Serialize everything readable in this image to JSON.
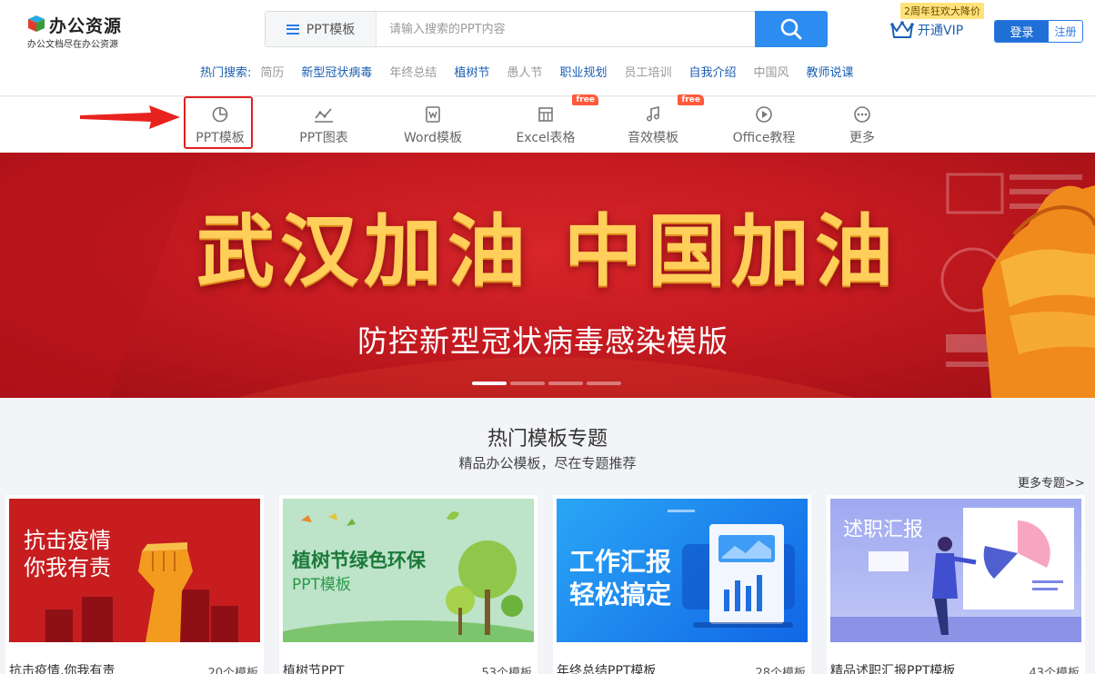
{
  "logo": {
    "title": "办公资源",
    "subtitle": "办公文档尽在办公资源"
  },
  "search": {
    "category": "PPT模板",
    "placeholder": "请输入搜索的PPT内容"
  },
  "promo": "2周年狂欢大降价",
  "vip": "开通VIP",
  "auth": {
    "login": "登录",
    "register": "注册"
  },
  "hot": {
    "label": "热门搜索:",
    "items": [
      {
        "text": "简历",
        "color": "#999999"
      },
      {
        "text": "新型冠状病毒",
        "color": "#1a5fb4"
      },
      {
        "text": "年终总结",
        "color": "#999999"
      },
      {
        "text": "植树节",
        "color": "#1a5fb4"
      },
      {
        "text": "愚人节",
        "color": "#999999"
      },
      {
        "text": "职业规划",
        "color": "#1a5fb4"
      },
      {
        "text": "员工培训",
        "color": "#999999"
      },
      {
        "text": "自我介绍",
        "color": "#1a5fb4"
      },
      {
        "text": "中国风",
        "color": "#999999"
      },
      {
        "text": "教师说课",
        "color": "#1a5fb4"
      }
    ]
  },
  "nav": [
    {
      "label": "PPT模板",
      "icon": "pie-chart-icon"
    },
    {
      "label": "PPT图表",
      "icon": "line-chart-icon"
    },
    {
      "label": "Word模板",
      "icon": "word-doc-icon"
    },
    {
      "label": "Excel表格",
      "icon": "table-icon",
      "tag": "free"
    },
    {
      "label": "音效模板",
      "icon": "music-icon",
      "tag": "free"
    },
    {
      "label": "Office教程",
      "icon": "play-icon"
    },
    {
      "label": "更多",
      "icon": "more-icon"
    }
  ],
  "banner": {
    "title": "武汉加油 中国加油",
    "subtitle": "防控新型冠状病毒感染模版"
  },
  "section": {
    "title": "热门模板专题",
    "subtitle": "精品办公模板，尽在专题推荐",
    "more": "更多专题>>"
  },
  "cards": [
    {
      "name": "抗击疫情,你我有责",
      "count": "20个模板",
      "image_text": [
        "抗击疫情",
        "你我有责"
      ]
    },
    {
      "name": "植树节PPT",
      "count": "53个模板",
      "image_text": [
        "植树节绿色环保",
        "PPT模板"
      ]
    },
    {
      "name": "年终总结PPT模板",
      "count": "28个模板",
      "image_text": [
        "工作汇报",
        "轻松搞定"
      ]
    },
    {
      "name": "精品述职汇报PPT模板",
      "count": "43个模板",
      "image_text": [
        "述职汇报"
      ]
    }
  ],
  "colors": {
    "brand_blue": "#2d8cf0",
    "banner_red": "#c41a20",
    "highlight_red": "#e02020"
  }
}
